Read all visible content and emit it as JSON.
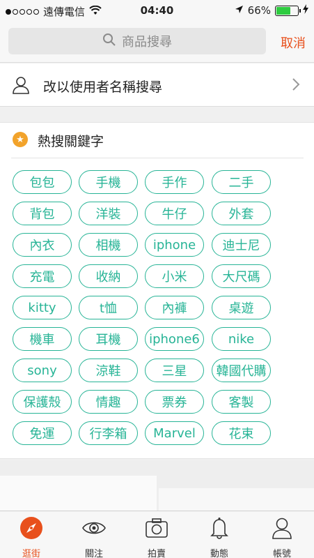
{
  "status_bar": {
    "carrier": "遠傳電信",
    "time": "04:40",
    "battery_percent": "66%",
    "battery_level": 0.66,
    "signal_dots_filled": 1,
    "signal_dots_total": 5
  },
  "search": {
    "placeholder": "商品搜尋",
    "cancel_label": "取消"
  },
  "user_search": {
    "label": "改以使用者名稱搜尋"
  },
  "hot_keywords": {
    "title": "熱搜關鍵字",
    "tags": [
      [
        "包包",
        "手機",
        "手作",
        "二手"
      ],
      [
        "背包",
        "洋裝",
        "牛仔",
        "外套"
      ],
      [
        "內衣",
        "相機",
        "iphone",
        "迪士尼"
      ],
      [
        "充電",
        "收納",
        "小米",
        "大尺碼"
      ],
      [
        "kitty",
        "t恤",
        "內褲",
        "桌遊"
      ],
      [
        "機車",
        "耳機",
        "iphone6",
        "nike"
      ],
      [
        "sony",
        "涼鞋",
        "三星",
        "韓國代購"
      ],
      [
        "保護殼",
        "情趣",
        "票券",
        "客製"
      ],
      [
        "免運",
        "行李箱",
        "Marvel",
        "花束"
      ]
    ]
  },
  "tabbar": {
    "tabs": [
      {
        "label": "逛街",
        "icon": "compass-icon",
        "active": true
      },
      {
        "label": "關注",
        "icon": "eye-icon",
        "active": false
      },
      {
        "label": "拍賣",
        "icon": "camera-icon",
        "active": false
      },
      {
        "label": "動態",
        "icon": "bell-icon",
        "active": false
      },
      {
        "label": "帳號",
        "icon": "person-icon",
        "active": false
      }
    ]
  },
  "colors": {
    "accent": "#e8501c",
    "tag_green": "#27b496",
    "star_orange": "#f2a32b"
  }
}
